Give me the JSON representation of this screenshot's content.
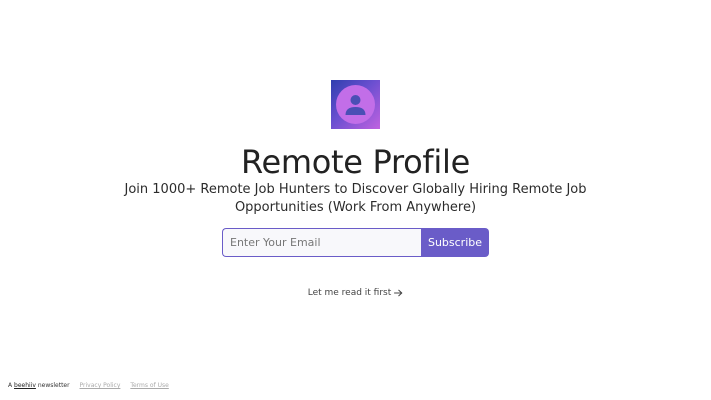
{
  "brand": {
    "title": "Remote Profile",
    "tagline": "Join 1000+ Remote Job Hunters to Discover Globally Hiring Remote Job Opportunities (Work From Anywhere)",
    "logo_icon": "user-avatar-icon",
    "accent_color": "#6a5cc8"
  },
  "form": {
    "email_placeholder": "Enter Your Email",
    "subscribe_label": "Subscribe"
  },
  "read_link": {
    "label": "Let me read it first",
    "icon": "arrow-right-icon"
  },
  "footer": {
    "prefix": "A",
    "brand": "beehiiv",
    "suffix": "newsletter",
    "privacy": "Privacy Policy",
    "terms": "Terms of Use"
  }
}
